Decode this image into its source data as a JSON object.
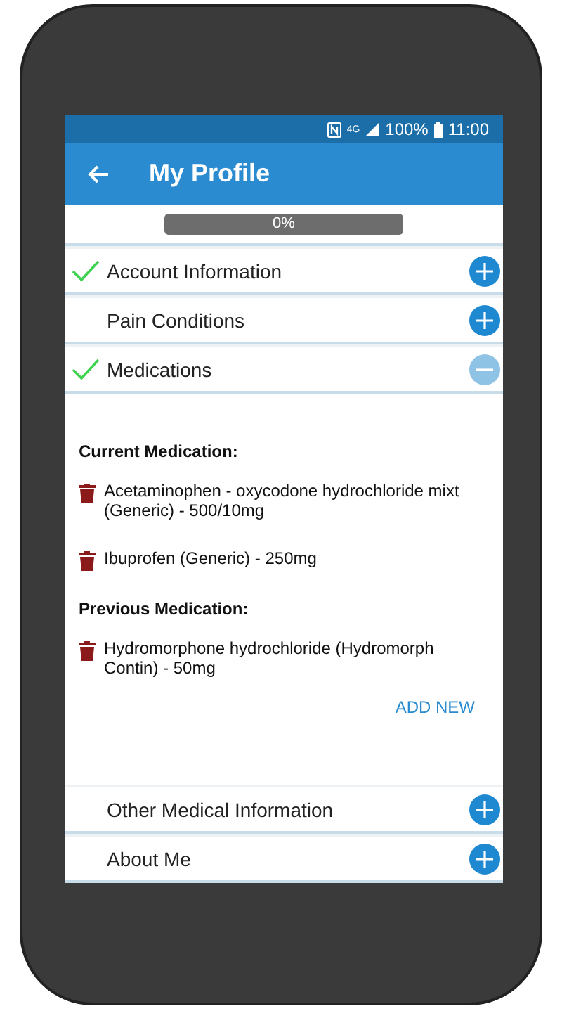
{
  "status_bar": {
    "network": "4G",
    "battery": "100%",
    "time": "11:00"
  },
  "app_bar": {
    "title": "My Profile"
  },
  "progress": {
    "level": 0,
    "reading": "0%"
  },
  "sections": [
    {
      "title": "Account Information",
      "completed": true,
      "expanded": false
    },
    {
      "title": "Pain Conditions",
      "completed": false,
      "expanded": false
    },
    {
      "title": "Medications",
      "completed": true,
      "expanded": true,
      "groups": [
        {
          "heading": "Current Medication:",
          "items": [
            "Acetaminophen - oxycodone hydrochloride mixt (Generic) - 500/10mg",
            "Ibuprofen (Generic) - 250mg"
          ]
        },
        {
          "heading": "Previous Medication:",
          "items": [
            "Hydromorphone hydrochloride (Hydromorph Contin) - 50mg"
          ]
        }
      ],
      "action": "ADD NEW"
    },
    {
      "title": "Other Medical Information",
      "completed": false,
      "expanded": false
    },
    {
      "title": "About Me",
      "completed": false,
      "expanded": false
    }
  ]
}
